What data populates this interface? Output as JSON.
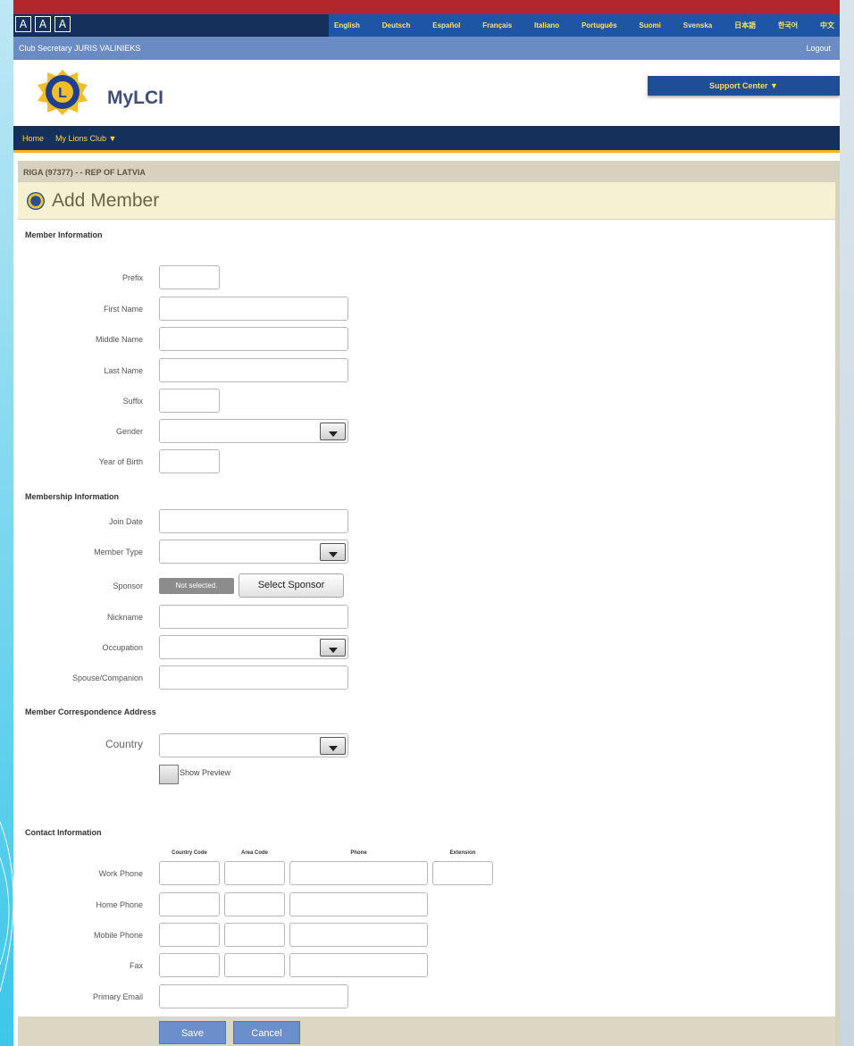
{
  "top": {
    "font_size_buttons": [
      "A",
      "A",
      "A"
    ],
    "languages": [
      "English",
      "Deutsch",
      "Español",
      "Français",
      "Italiano",
      "Português",
      "Suomi",
      "Svenska",
      "日本語",
      "한국어",
      "中文"
    ]
  },
  "secretary_bar": {
    "user": "Club Secretary JURIS VALINIEKS",
    "logout": "Logout"
  },
  "header": {
    "brand": "MyLCI",
    "support_center": "Support Center ▼"
  },
  "nav": {
    "home": "Home",
    "my_club": "My Lions Club ▼"
  },
  "breadcrumb": "RIGA (97377) - - REP OF LATVIA",
  "page_title": "Add Member",
  "member_info": {
    "heading": "Member Information",
    "prefix": "Prefix",
    "first_name": "First Name",
    "middle_name": "Middle Name",
    "last_name": "Last Name",
    "suffix": "Suffix",
    "gender": "Gender",
    "year_of_birth": "Year of Birth"
  },
  "membership_info": {
    "heading": "Membership Information",
    "join_date": "Join Date",
    "member_type": "Member Type",
    "sponsor": "Sponsor",
    "sponsor_status": "Not selected.",
    "select_sponsor": "Select Sponsor",
    "nickname": "Nickname",
    "occupation": "Occupation",
    "spouse": "Spouse/Companion"
  },
  "address": {
    "heading": "Member Correspondence Address",
    "country": "Country",
    "show_preview": "Show Preview"
  },
  "contact": {
    "heading": "Contact Information",
    "columns": [
      "Country Code",
      "Area Code",
      "Phone",
      "Extension"
    ],
    "work_phone": "Work Phone",
    "home_phone": "Home Phone",
    "mobile_phone": "Mobile Phone",
    "fax": "Fax",
    "primary_email": "Primary Email"
  },
  "footer": {
    "save": "Save",
    "cancel": "Cancel"
  },
  "colors": {
    "top_red": "#b3262c",
    "navy": "#16305c",
    "lang_bar": "#1e55a4",
    "secretary_bar": "#6a8bc3",
    "nav_accent": "#f4b41a",
    "title_bg": "#f6f1d3",
    "button_blue": "#6b8fca"
  }
}
